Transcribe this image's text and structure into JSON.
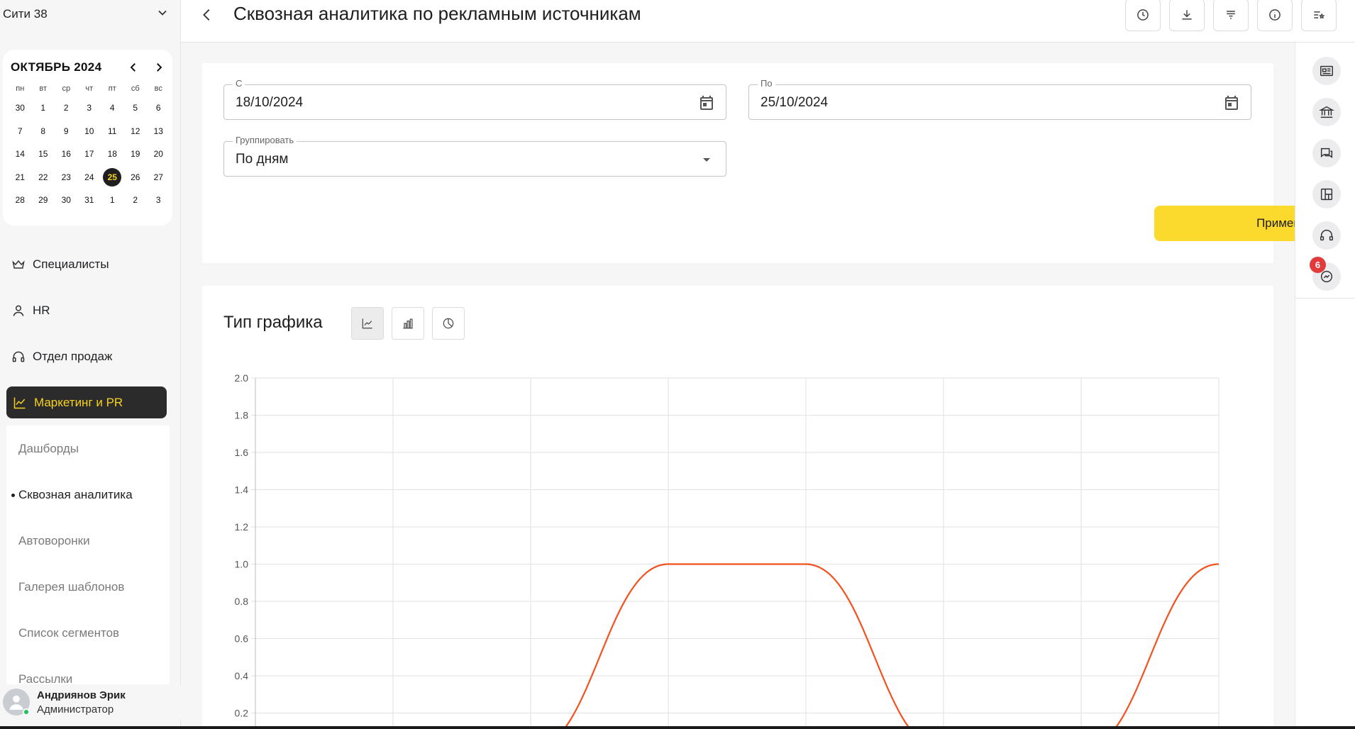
{
  "sidebar": {
    "org_name": "Сити 38",
    "calendar": {
      "month_title": "ОКТЯБРЬ 2024",
      "weekdays": [
        "пн",
        "вт",
        "ср",
        "чт",
        "пт",
        "сб",
        "вс"
      ],
      "days": [
        "30",
        "1",
        "2",
        "3",
        "4",
        "5",
        "6",
        "7",
        "8",
        "9",
        "10",
        "11",
        "12",
        "13",
        "14",
        "15",
        "16",
        "17",
        "18",
        "19",
        "20",
        "21",
        "22",
        "23",
        "24",
        "25",
        "26",
        "27",
        "28",
        "29",
        "30",
        "31",
        "1",
        "2",
        "3"
      ],
      "today": "25"
    },
    "nav": [
      {
        "label": "Специалисты",
        "icon": "crown-icon"
      },
      {
        "label": "HR",
        "icon": "person-icon"
      },
      {
        "label": "Отдел продаж",
        "icon": "headset-icon"
      },
      {
        "label": "Маркетинг и PR",
        "icon": "line-chart-icon"
      }
    ],
    "subnav": [
      {
        "label": "Дашборды"
      },
      {
        "label": "Сквозная аналитика"
      },
      {
        "label": "Автоворонки"
      },
      {
        "label": "Галерея шаблонов"
      },
      {
        "label": "Список сегментов"
      },
      {
        "label": "Рассылки"
      }
    ],
    "user": {
      "name": "Андриянов Эрик",
      "role": "Администратор"
    }
  },
  "header": {
    "title": "Сквозная аналитика по рекламным источникам",
    "tools": [
      "clock-icon",
      "download-icon",
      "filter-list-icon",
      "info-icon",
      "settings-list-icon"
    ]
  },
  "filters": {
    "from": {
      "label": "С",
      "value": "18/10/2024"
    },
    "to": {
      "label": "По",
      "value": "25/10/2024"
    },
    "group": {
      "label": "Группировать",
      "value": "По дням"
    },
    "apply_label": "Применить"
  },
  "chart_section": {
    "title": "Тип графика",
    "types": [
      "line-chart-icon",
      "bar-chart-icon",
      "pie-chart-icon"
    ],
    "active_type": "line"
  },
  "chart_data": {
    "type": "line",
    "title": "",
    "xlabel": "",
    "ylabel": "",
    "ylim": [
      0,
      2.0
    ],
    "y_ticks": [
      "0.2",
      "0.4",
      "0.6",
      "0.8",
      "1.0",
      "1.2",
      "1.4",
      "1.6",
      "1.8",
      "2.0"
    ],
    "x_count": 8,
    "grid": true,
    "series": [
      {
        "color": "#f4511e",
        "values": [
          0,
          0,
          0,
          1,
          1,
          0,
          0,
          1
        ]
      }
    ]
  },
  "right_rail": {
    "icons": [
      "id-card-icon",
      "bank-icon",
      "chat-icon",
      "board-icon",
      "support-headset-icon",
      "messenger-icon"
    ],
    "badge": "6"
  },
  "colors": {
    "accent": "#fbd92d",
    "nav_active_bg": "#2b2b2b",
    "nav_active_text": "#f7d21f",
    "series": "#f4511e"
  }
}
